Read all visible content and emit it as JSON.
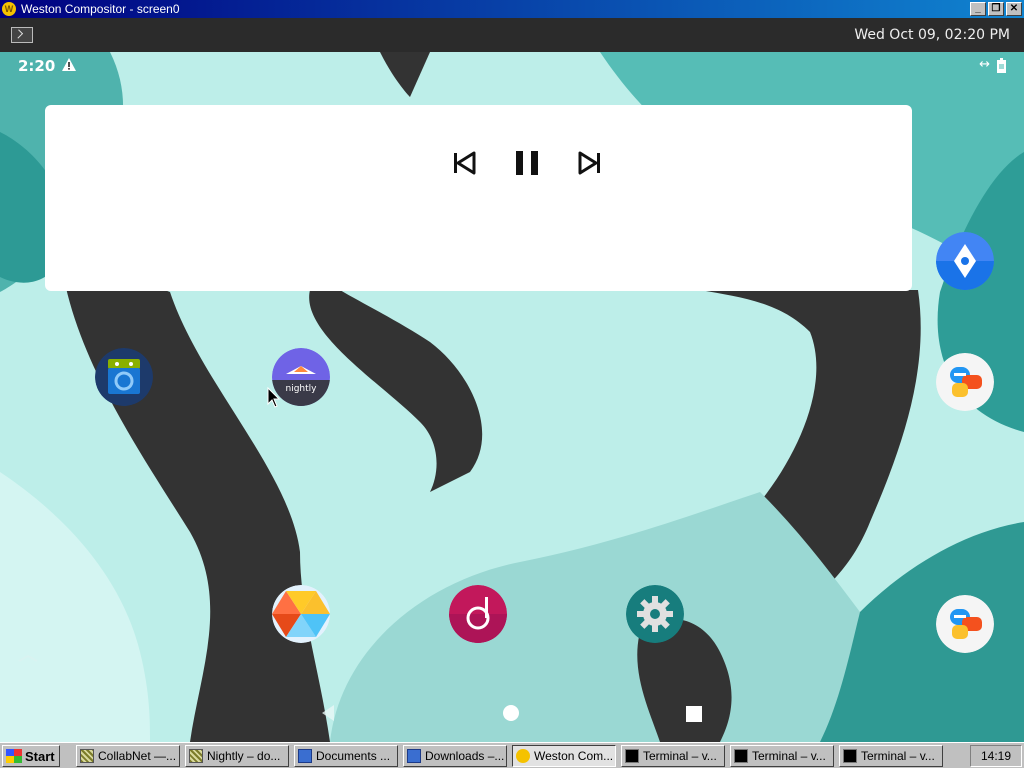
{
  "window": {
    "title": "Weston Compositor - screen0",
    "controls": [
      "minimize",
      "restore",
      "close"
    ]
  },
  "weston_panel": {
    "launcher_icon": "terminal-icon",
    "clock": "Wed Oct 09, 02:20 PM"
  },
  "android": {
    "status_bar": {
      "time": "2:20",
      "icons": [
        "warning-icon",
        "data-sync-icon",
        "battery-icon"
      ]
    },
    "media_widget": {
      "buttons": [
        "previous-track-icon",
        "pause-icon",
        "next-track-icon"
      ]
    },
    "apps": [
      {
        "name": "F-Droid",
        "icon": "fdroid-icon"
      },
      {
        "name": "Nightly",
        "label": "nightly",
        "icon": "firefox-nightly-icon"
      },
      {
        "name": "Gallery",
        "icon": "gallery-icon"
      },
      {
        "name": "Music",
        "icon": "music-icon"
      },
      {
        "name": "Settings",
        "icon": "settings-gear-icon"
      }
    ],
    "side_apps": [
      "maps-icon",
      "messaging-icon",
      "messaging-icon"
    ],
    "nav_bar": [
      "back-icon",
      "home-icon",
      "recents-icon"
    ]
  },
  "taskbar": {
    "start_label": "Start",
    "items": [
      {
        "label": "CollabNet —...",
        "icon": "grid-icon",
        "active": false
      },
      {
        "label": "Nightly – do...",
        "icon": "grid-icon",
        "active": false
      },
      {
        "label": "Documents ...",
        "icon": "folder-icon",
        "active": false
      },
      {
        "label": "Downloads –...",
        "icon": "folder-icon",
        "active": false
      },
      {
        "label": "Weston Com...",
        "icon": "weston-icon",
        "active": true
      },
      {
        "label": "Terminal – v...",
        "icon": "terminal-icon",
        "active": false
      },
      {
        "label": "Terminal – v...",
        "icon": "terminal-icon",
        "active": false
      },
      {
        "label": "Terminal – v...",
        "icon": "terminal-icon",
        "active": false
      }
    ],
    "clock": "14:19"
  }
}
